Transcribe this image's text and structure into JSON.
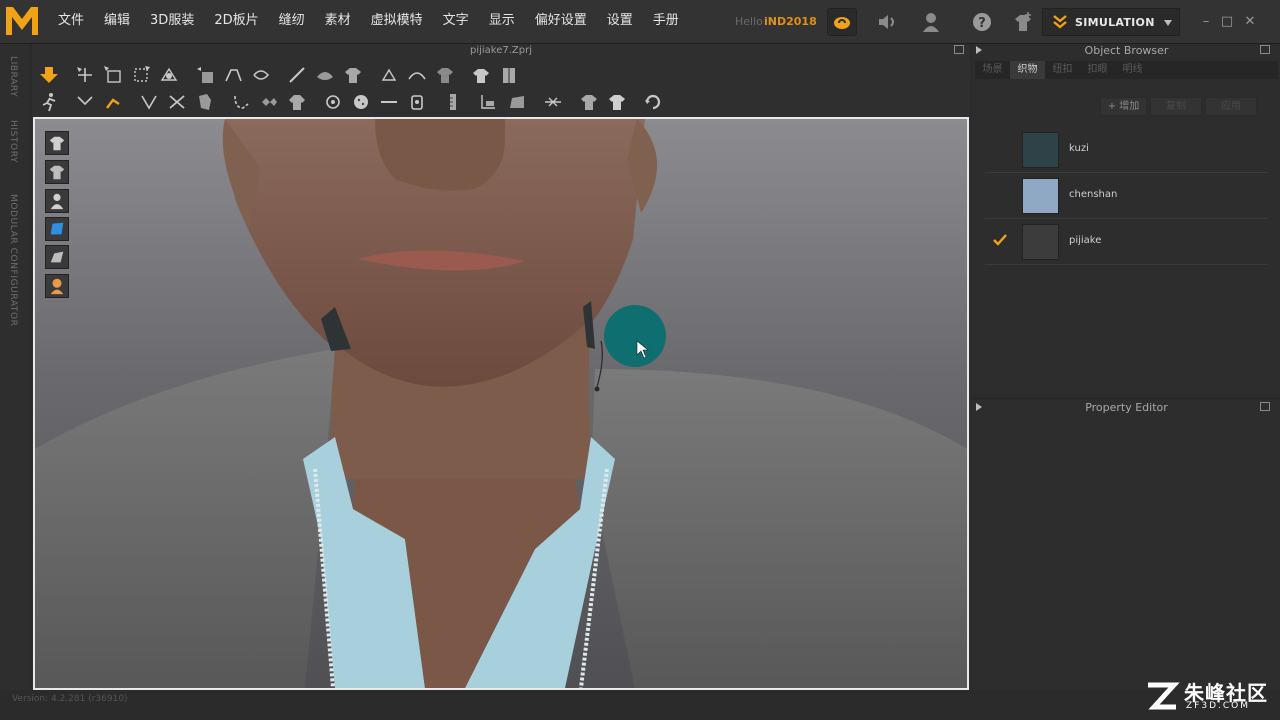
{
  "menu": {
    "items": [
      "文件",
      "编辑",
      "3D服装",
      "2D板片",
      "缝纫",
      "素材",
      "虚拟模特",
      "文字",
      "显示",
      "偏好设置",
      "设置",
      "手册"
    ]
  },
  "account": {
    "hello": "Hello",
    "username": "iND2018"
  },
  "mode": {
    "label": "SIMULATION"
  },
  "left_tabs": [
    "LIBRARY",
    "HISTORY",
    "MODULAR CONFIGURATOR"
  ],
  "workspace": {
    "title": "pijiake7.Zprj"
  },
  "object_browser": {
    "title": "Object Browser",
    "tabs": [
      "场景",
      "织物",
      "纽扣",
      "扣眼",
      "明线"
    ],
    "active_tab": 1,
    "buttons": {
      "add": "+ 增加",
      "copy": "复制",
      "apply": "应用"
    },
    "fabrics": [
      {
        "name": "kuzi",
        "color": "#2f4248",
        "selected": false
      },
      {
        "name": "chenshan",
        "color": "#8fa8c4",
        "selected": false
      },
      {
        "name": "pijiake",
        "color": "#3c3c3c",
        "selected": true
      }
    ]
  },
  "property_editor": {
    "title": "Property Editor"
  },
  "version": "Version: 4.2.281 (r36910)",
  "watermark": {
    "cn": "朱峰社区",
    "en": "ZF3D.COM"
  },
  "colors": {
    "accent": "#f0a317",
    "viewport_border": "#e8e8e8",
    "cursor_circle": "#0e6e70"
  }
}
